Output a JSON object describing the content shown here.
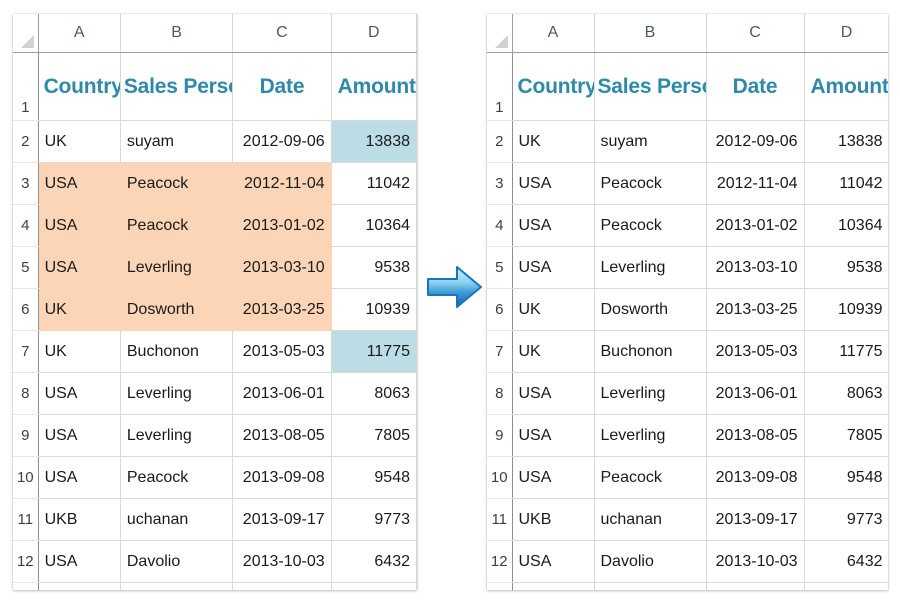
{
  "columns": {
    "letters": [
      "A",
      "B",
      "C",
      "D"
    ],
    "corner_icon": "select-all-triangle-icon"
  },
  "headers": {
    "row_label": "1",
    "country": "Country",
    "sales_person": "Sales Person",
    "date": "Date",
    "amount": "Amount"
  },
  "colors": {
    "header_text": "#2f89a8",
    "highlight_orange": "#fbd5b5",
    "highlight_blue": "#bcdde5",
    "arrow_light": "#a8dcf0",
    "arrow_dark": "#0f6cb5",
    "gridline": "#d9d9d9"
  },
  "arrow": {
    "icon": "right-arrow-icon",
    "direction": "right"
  },
  "rows": [
    {
      "n": "2",
      "country": "UK",
      "person": "suyam",
      "date": "2012-09-06",
      "amount": "13838"
    },
    {
      "n": "3",
      "country": "USA",
      "person": "Peacock",
      "date": "2012-11-04",
      "amount": "11042"
    },
    {
      "n": "4",
      "country": "USA",
      "person": "Peacock",
      "date": "2013-01-02",
      "amount": "10364"
    },
    {
      "n": "5",
      "country": "USA",
      "person": "Leverling",
      "date": "2013-03-10",
      "amount": "9538"
    },
    {
      "n": "6",
      "country": "UK",
      "person": "Dosworth",
      "date": "2013-03-25",
      "amount": "10939"
    },
    {
      "n": "7",
      "country": "UK",
      "person": "Buchonon",
      "date": "2013-05-03",
      "amount": "11775"
    },
    {
      "n": "8",
      "country": "USA",
      "person": "Leverling",
      "date": "2013-06-01",
      "amount": "8063"
    },
    {
      "n": "9",
      "country": "USA",
      "person": "Leverling",
      "date": "2013-08-05",
      "amount": "7805"
    },
    {
      "n": "10",
      "country": "USA",
      "person": "Peacock",
      "date": "2013-09-08",
      "amount": "9548"
    },
    {
      "n": "11",
      "country": "UKB",
      "person": "uchanan",
      "date": "2013-09-17",
      "amount": "9773"
    },
    {
      "n": "12",
      "country": "USA",
      "person": "Davolio",
      "date": "2013-10-03",
      "amount": "6432"
    }
  ],
  "left_sheet": {
    "name": "before-sheet",
    "orange_fill_rows": [
      "3",
      "4",
      "5",
      "6"
    ],
    "orange_fill_columns": [
      "A",
      "B",
      "C"
    ],
    "blue_fill_cells": [
      "D2",
      "D7"
    ]
  },
  "right_sheet": {
    "name": "after-sheet",
    "orange_fill_rows": [],
    "blue_fill_cells": []
  }
}
